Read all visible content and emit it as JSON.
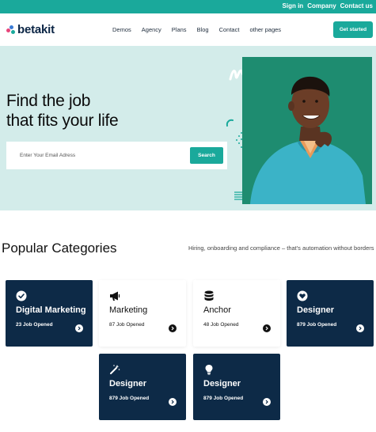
{
  "topbar": {
    "links": [
      "Sign in",
      "Company",
      "Contact us"
    ]
  },
  "brand": {
    "name": "betakit"
  },
  "nav": {
    "items": [
      "Demos",
      "Agency",
      "Plans",
      "Blog",
      "Contact",
      "other pages"
    ],
    "cta": "Get started"
  },
  "hero": {
    "title_line1": "Find the job",
    "title_line2": "that fits your life",
    "email_placeholder": "Enter Your Email Adress",
    "search_label": "Search"
  },
  "categories": {
    "title": "Popular Categories",
    "subtitle": "Hiring, onboarding and compliance – that's automation without borders",
    "cards": [
      {
        "icon": "check-circle-icon",
        "title": "Digital Marketing",
        "count": "23 Job Opened",
        "theme": "dark"
      },
      {
        "icon": "megaphone-icon",
        "title": "Marketing",
        "count": "87 Job Opened",
        "theme": "light"
      },
      {
        "icon": "database-icon",
        "title": "Anchor",
        "count": "48 Job Opened",
        "theme": "light"
      },
      {
        "icon": "heart-circle-icon",
        "title": "Designer",
        "count": "879 Job Opened",
        "theme": "dark"
      },
      {
        "icon": "magic-wand-icon",
        "title": "Designer",
        "count": "879 Job Opened",
        "theme": "dark"
      },
      {
        "icon": "lightbulb-icon",
        "title": "Designer",
        "count": "879 Job Opened",
        "theme": "dark"
      }
    ]
  },
  "colors": {
    "accent": "#1aa99b",
    "navy": "#0d2a47",
    "hero_bg": "#d3ecea",
    "photo_bg": "#1d8870"
  }
}
